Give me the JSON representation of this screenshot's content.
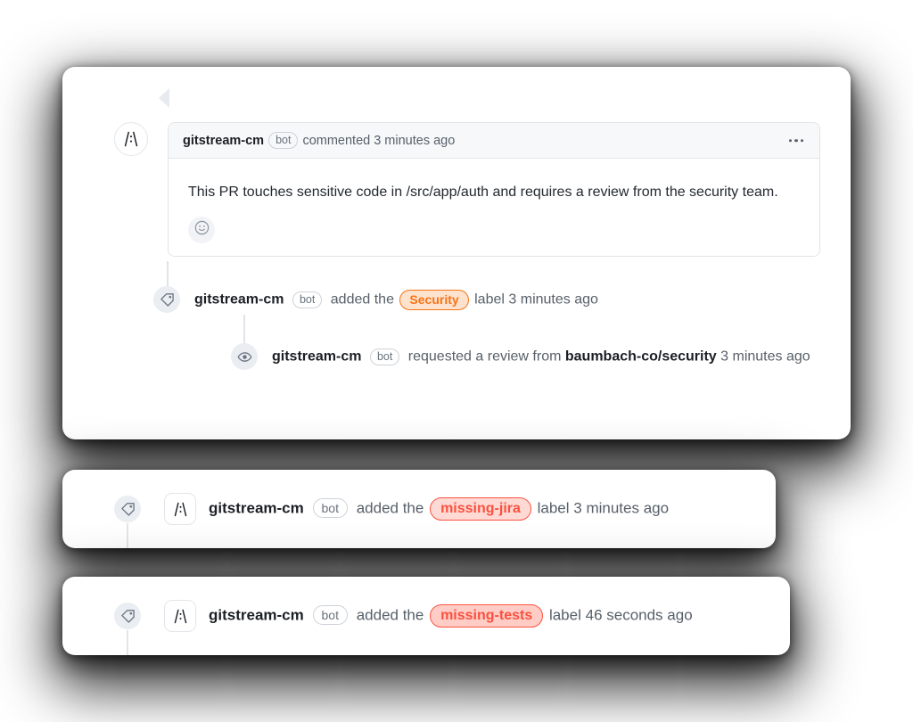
{
  "comment": {
    "avatar_icon": "gitstream-logo-icon",
    "author": "gitstream-cm",
    "bot_badge": "bot",
    "action": "commented",
    "timestamp": "3 minutes ago",
    "menu_icon": "kebab-menu-icon",
    "body": "This PR touches sensitive code in /src/app/auth and requires a review from the security team.",
    "reaction_icon": "smiley-face-icon"
  },
  "timeline": [
    {
      "icon": "tag-icon",
      "author": "gitstream-cm",
      "bot_badge": "bot",
      "action_before": "added the",
      "label": "Security",
      "label_color": "#f97316",
      "label_bg": "#fde3cd",
      "action_after": "label",
      "timestamp": "3 minutes ago"
    },
    {
      "icon": "eye-icon",
      "author": "gitstream-cm",
      "bot_badge": "bot",
      "action_before": "requested a review from",
      "target": "baumbach-co/security",
      "timestamp": "3 minutes ago"
    }
  ],
  "cards": [
    {
      "icon": "tag-icon",
      "avatar_icon": "gitstream-logo-icon",
      "author": "gitstream-cm",
      "bot_badge": "bot",
      "action_before": "added the",
      "label": "missing-jira",
      "label_color": "#f9513f",
      "label_bg": "#ffd9d4",
      "action_after": "label",
      "timestamp": "3 minutes ago"
    },
    {
      "icon": "tag-icon",
      "avatar_icon": "gitstream-logo-icon",
      "author": "gitstream-cm",
      "bot_badge": "bot",
      "action_before": "added the",
      "label": "missing-tests",
      "label_color": "#f9513f",
      "label_bg": "#ffcdc6",
      "action_after": "label",
      "timestamp": "46 seconds ago"
    }
  ]
}
